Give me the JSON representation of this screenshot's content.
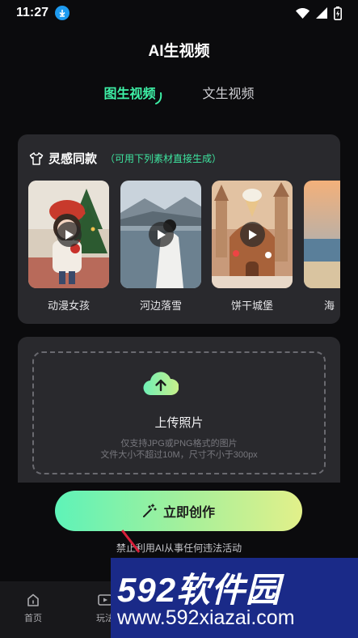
{
  "status_bar": {
    "time": "11:27"
  },
  "header": {
    "title": "AI生视频"
  },
  "mode_tabs": [
    {
      "label": "图生视频",
      "active": true
    },
    {
      "label": "文生视频",
      "active": false
    }
  ],
  "inspiration": {
    "title": "灵感同款",
    "subtitle": "（可用下列素材直接生成）",
    "items": [
      {
        "label": "动漫女孩"
      },
      {
        "label": "河边落雪"
      },
      {
        "label": "饼干城堡"
      },
      {
        "label": "海"
      }
    ]
  },
  "upload": {
    "title": "上传照片",
    "hint_line1": "仅支持JPG或PNG格式的图片",
    "hint_line2": "文件大小不超过10M，尺寸不小于300px"
  },
  "action": {
    "create_label": "立即创作"
  },
  "disclaimer": "禁止利用AI从事任何违法活动",
  "bottom_nav": [
    {
      "label": "首页",
      "icon": "home-icon"
    },
    {
      "label": "玩法",
      "icon": "play-icon"
    }
  ],
  "watermark": {
    "big": "592软件园",
    "small": "www.592xiazai.com"
  },
  "colors": {
    "accent": "#3ef0a6",
    "card": "#29292d",
    "background": "#0b0b0d"
  }
}
